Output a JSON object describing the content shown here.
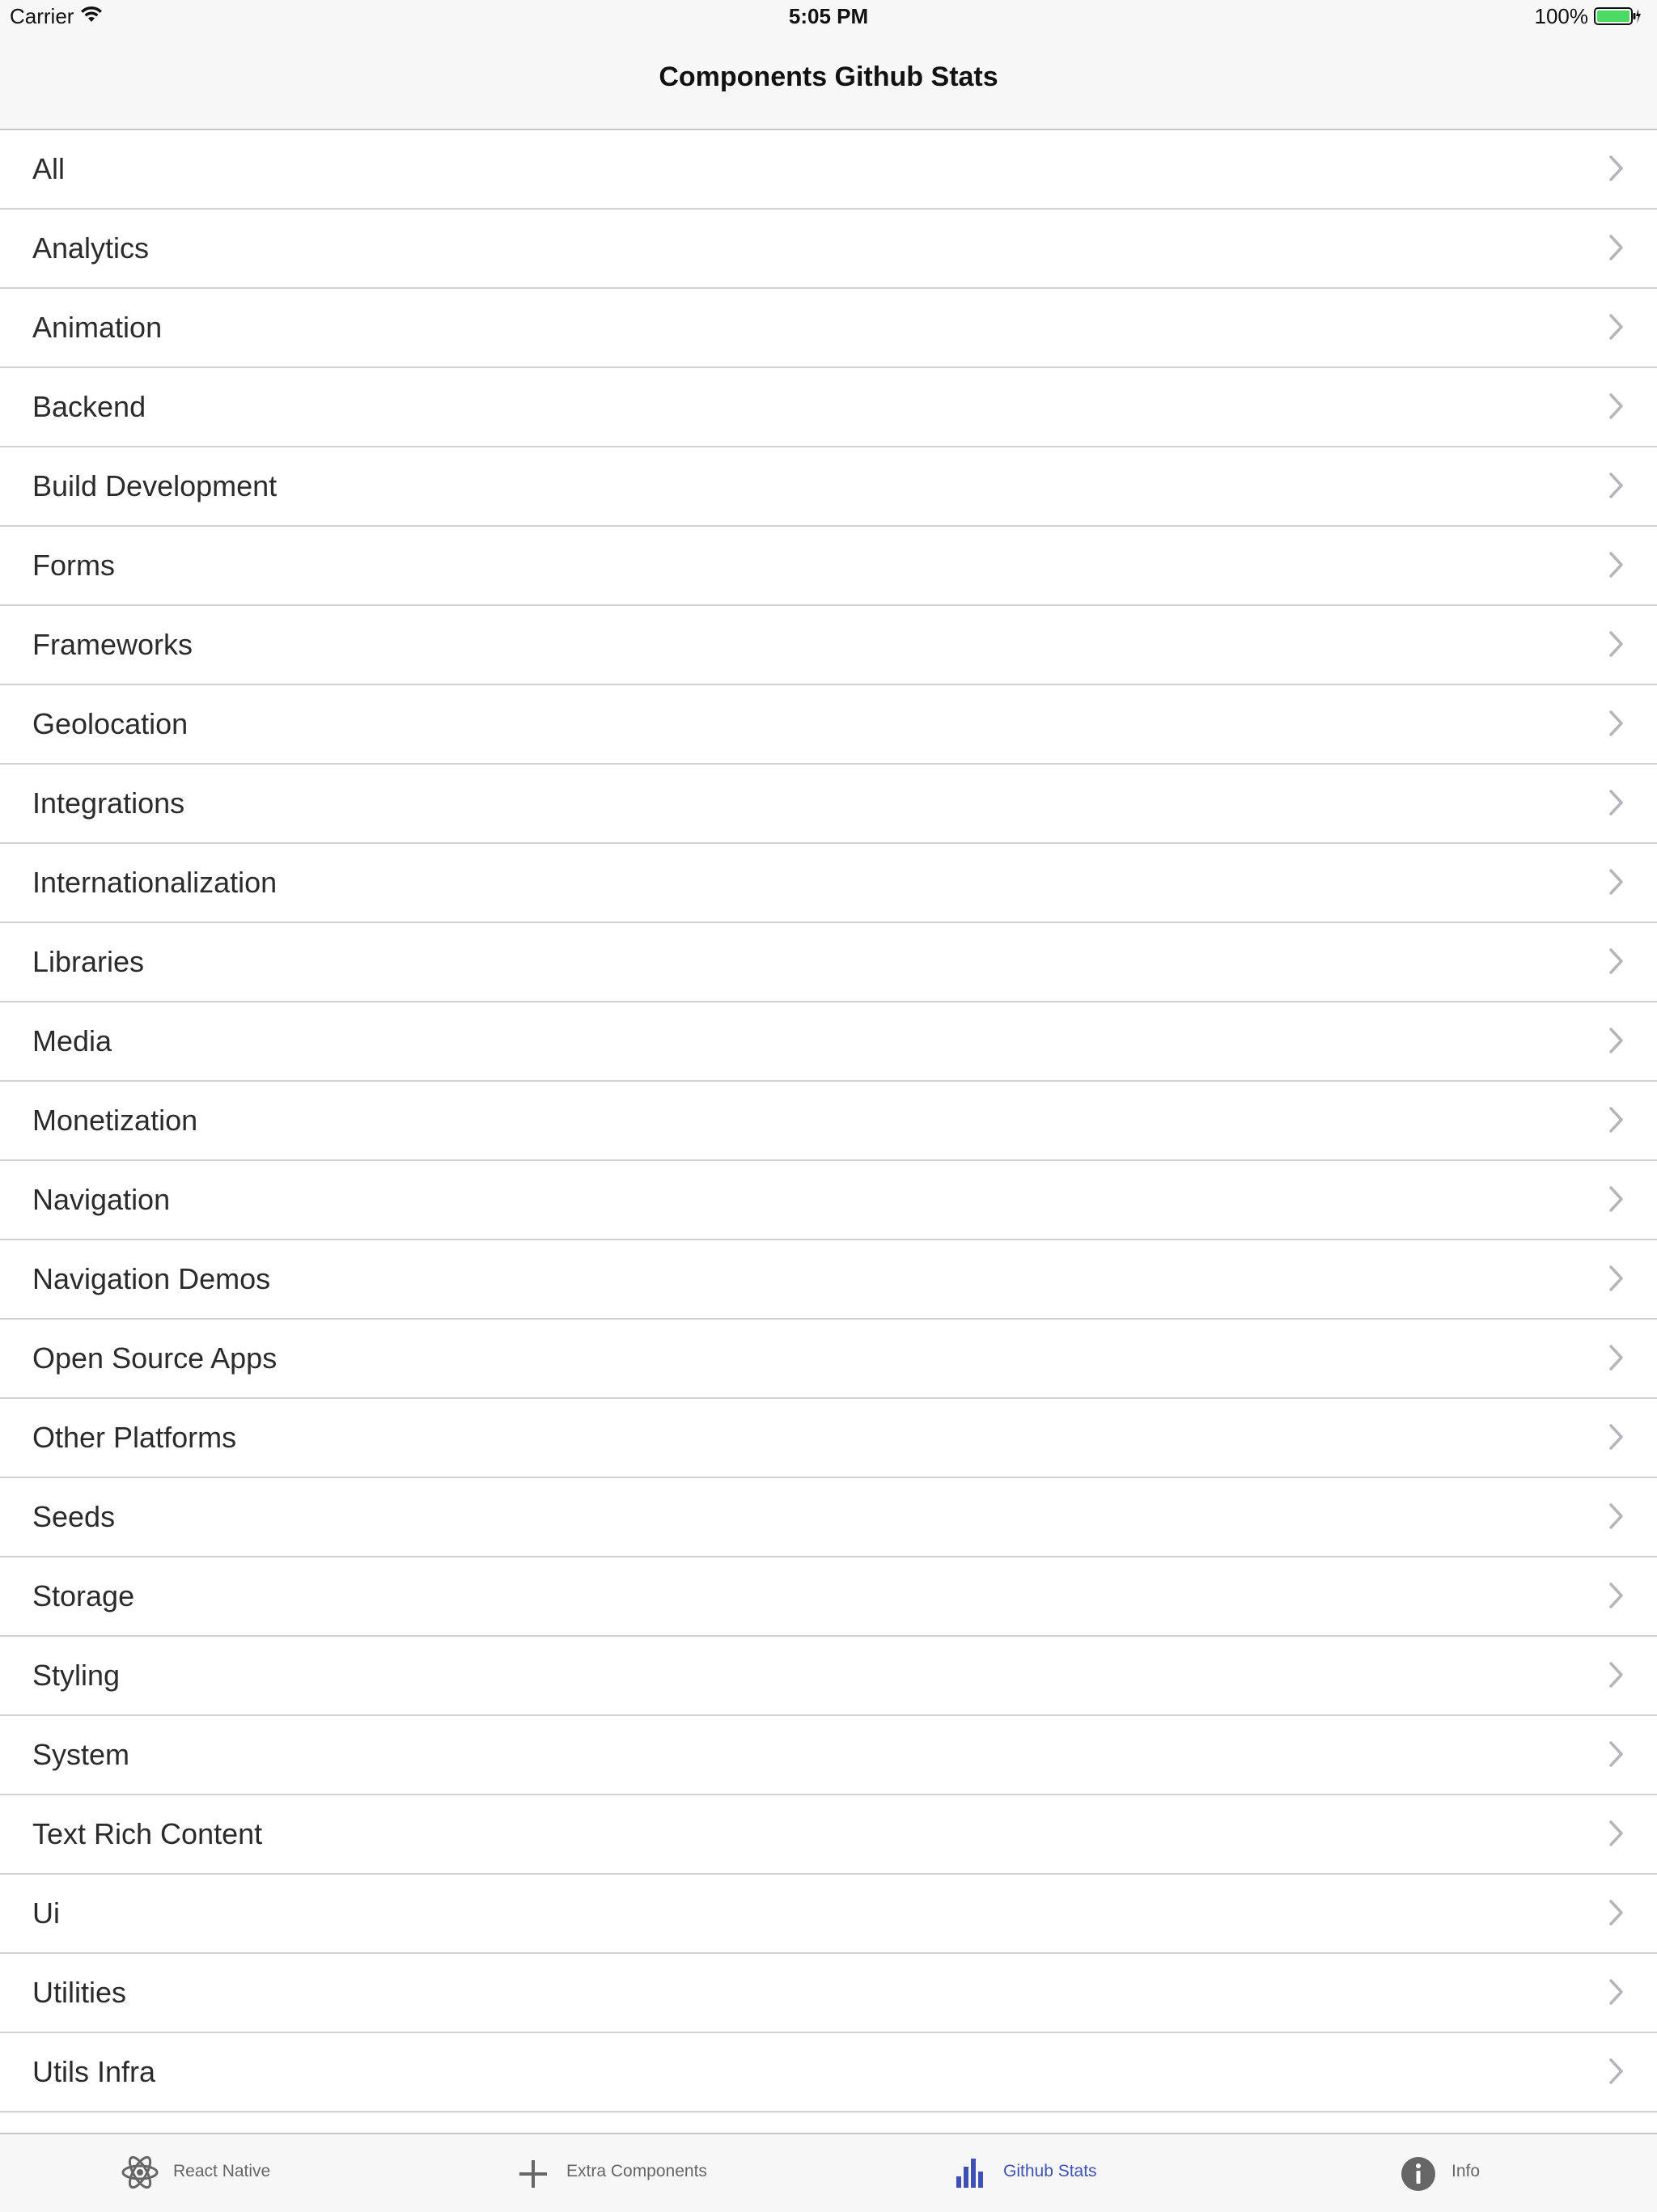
{
  "status_bar": {
    "carrier": "Carrier",
    "time": "5:05 PM",
    "battery": "100%"
  },
  "nav": {
    "title": "Components Github Stats"
  },
  "list": {
    "items": [
      "All",
      "Analytics",
      "Animation",
      "Backend",
      "Build Development",
      "Forms",
      "Frameworks",
      "Geolocation",
      "Integrations",
      "Internationalization",
      "Libraries",
      "Media",
      "Monetization",
      "Navigation",
      "Navigation Demos",
      "Open Source Apps",
      "Other Platforms",
      "Seeds",
      "Storage",
      "Styling",
      "System",
      "Text Rich Content",
      "Ui",
      "Utilities",
      "Utils Infra"
    ]
  },
  "tabs": [
    {
      "label": "React Native",
      "icon": "atom-icon",
      "active": false
    },
    {
      "label": "Extra Components",
      "icon": "plus-icon",
      "active": false
    },
    {
      "label": "Github Stats",
      "icon": "bar-chart-icon",
      "active": true
    },
    {
      "label": "Info",
      "icon": "info-icon",
      "active": false
    }
  ],
  "colors": {
    "accent": "#3f51b5",
    "inactive_tab": "#666666",
    "separator": "#d2d2d6",
    "battery": "#4cd964"
  }
}
